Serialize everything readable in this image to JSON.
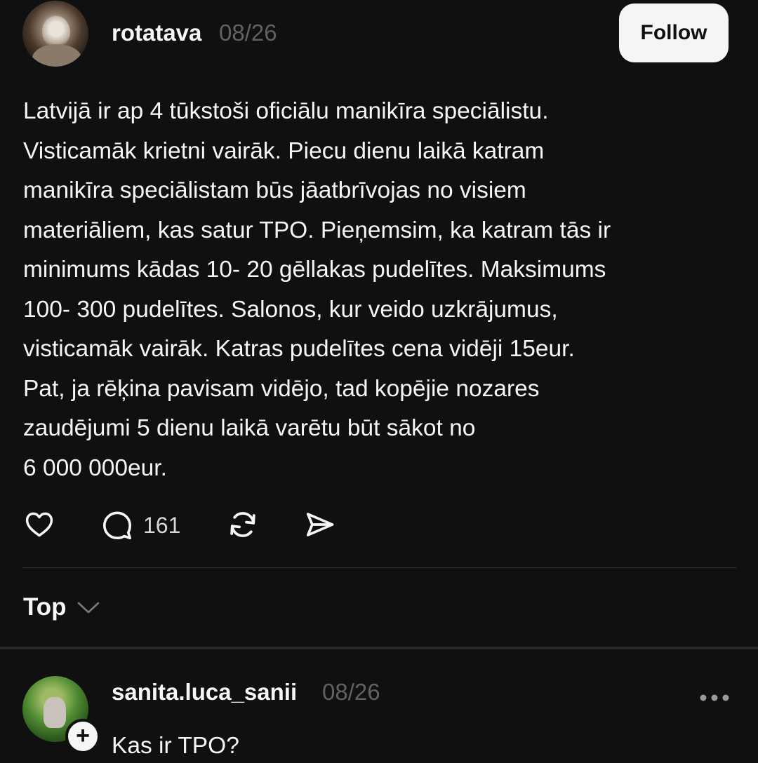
{
  "post": {
    "username": "rotatava",
    "date": "08/26",
    "follow_label": "Follow",
    "lines": [
      "Latvijā ir ap 4 tūkstoši oficiālu manikīra speciālistu.",
      "Visticamāk krietni vairāk. Piecu dienu laikā katram",
      "manikīra speciālistam būs jāatbrīvojas no visiem",
      "materiāliem, kas satur TPO. Pieņemsim, ka katram tās ir",
      "minimums kādas 10- 20 gēllakas pudelītes. Maksimums",
      "100- 300 pudelītes. Salonos, kur veido uzkrājumus,",
      "visticamāk vairāk. Katras pudelītes cena vidēji 15eur.",
      "Pat, ja rēķina pavisam vidējo, tad kopējie nozares",
      "zaudējumi 5 dienu laikā varētu būt sākot no",
      "6 000 000eur."
    ],
    "actions": {
      "like_icon": "heart-icon",
      "comment_icon": "comment-icon",
      "comment_count": "161",
      "repost_icon": "repost-icon",
      "share_icon": "share-icon"
    }
  },
  "replies_sort": {
    "label": "Top",
    "icon": "chevron-down-icon"
  },
  "reply": {
    "username": "sanita.luca_sanii",
    "date": "08/26",
    "follow_badge": "+",
    "more_icon": "more-icon",
    "text": "Kas ir TPO?"
  },
  "colors": {
    "background": "#101010",
    "text": "#f3f5f7",
    "muted": "#616161",
    "button_bg": "#f5f5f5"
  }
}
